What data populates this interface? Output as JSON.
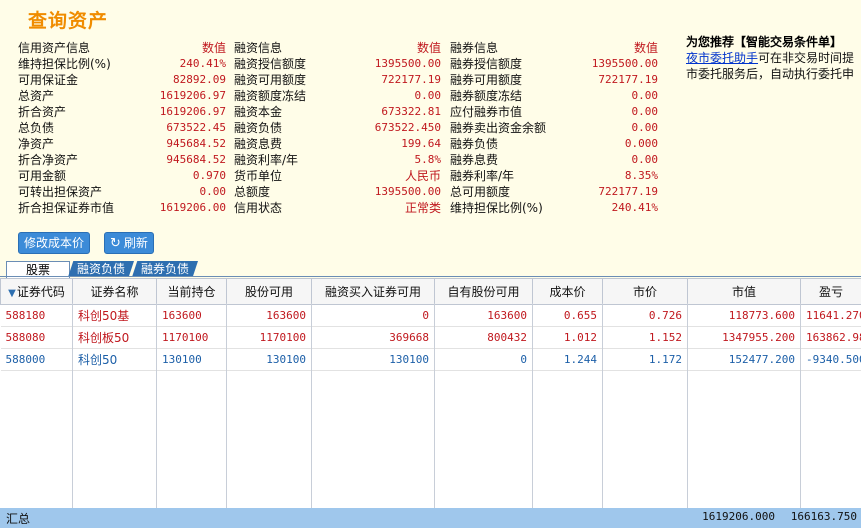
{
  "page_title": "查询资产",
  "credit": {
    "header_label": "信用资产信息",
    "header_value": "数值",
    "rows": [
      {
        "label": "维持担保比例(%)",
        "value": "240.41%"
      },
      {
        "label": "可用保证金",
        "value": "82892.09"
      },
      {
        "label": "总资产",
        "value": "1619206.97"
      },
      {
        "label": "折合资产",
        "value": "1619206.97"
      },
      {
        "label": "总负债",
        "value": "673522.45"
      },
      {
        "label": "净资产",
        "value": "945684.52"
      },
      {
        "label": "折合净资产",
        "value": "945684.52"
      },
      {
        "label": "可用金额",
        "value": "0.970"
      },
      {
        "label": "可转出担保资产",
        "value": "0.00"
      },
      {
        "label": "折合担保证券市值",
        "value": "1619206.00"
      }
    ]
  },
  "margin_finance": {
    "header_label": "融资信息",
    "header_value": "数值",
    "rows": [
      {
        "label": "融资授信额度",
        "value": "1395500.00"
      },
      {
        "label": "融资可用额度",
        "value": "722177.19"
      },
      {
        "label": "融资额度冻结",
        "value": "0.00"
      },
      {
        "label": "融资本金",
        "value": "673322.81"
      },
      {
        "label": "融资负债",
        "value": "673522.450"
      },
      {
        "label": "融资息费",
        "value": "199.64"
      },
      {
        "label": "融资利率/年",
        "value": "5.8%"
      },
      {
        "label": "货币单位",
        "value": "人民币"
      },
      {
        "label": "总额度",
        "value": "1395500.00"
      },
      {
        "label": "信用状态",
        "value": "正常类"
      }
    ]
  },
  "short_sell": {
    "header_label": "融券信息",
    "header_value": "数值",
    "rows": [
      {
        "label": "融券授信额度",
        "value": "1395500.00"
      },
      {
        "label": "融券可用额度",
        "value": "722177.19"
      },
      {
        "label": "融券额度冻结",
        "value": "0.00"
      },
      {
        "label": "应付融券市值",
        "value": "0.00"
      },
      {
        "label": "融券卖出资金余额",
        "value": "0.00"
      },
      {
        "label": "融券负债",
        "value": "0.000"
      },
      {
        "label": "融券息费",
        "value": "0.00"
      },
      {
        "label": "融券利率/年",
        "value": "8.35%"
      },
      {
        "label": "总可用额度",
        "value": "722177.19"
      },
      {
        "label": "维持担保比例(%)",
        "value": "240.41%"
      }
    ]
  },
  "recommend": {
    "title": "为您推荐【智能交易条件单】",
    "link": "夜市委托助手",
    "text1": "可在非交易时间提",
    "text2": "市委托服务后，自动执行委托申"
  },
  "buttons": {
    "modify_cost": "修改成本价",
    "refresh": "刷新"
  },
  "tabs": [
    "股票",
    "融资负债",
    "融券负债"
  ],
  "grid": {
    "headers": [
      "证券代码",
      "证券名称",
      "当前持仓",
      "股份可用",
      "融资买入证券可用",
      "自有股份可用",
      "成本价",
      "市价",
      "市值",
      "盈亏"
    ],
    "rows": [
      {
        "code": "588180",
        "name": "科创50基",
        "hold": "163600",
        "avail": "163600",
        "margin_avail": "0",
        "own_avail": "163600",
        "cost": "0.655",
        "price": "0.726",
        "mv": "118773.600",
        "pl": "11641.270",
        "color": "red"
      },
      {
        "code": "588080",
        "name": "科创板50",
        "hold": "1170100",
        "avail": "1170100",
        "margin_avail": "369668",
        "own_avail": "800432",
        "cost": "1.012",
        "price": "1.152",
        "mv": "1347955.200",
        "pl": "163862.980",
        "color": "red"
      },
      {
        "code": "588000",
        "name": "科创50",
        "hold": "130100",
        "avail": "130100",
        "margin_avail": "130100",
        "own_avail": "0",
        "cost": "1.244",
        "price": "1.172",
        "mv": "152477.200",
        "pl": "-9340.500",
        "color": "blue"
      }
    ]
  },
  "summary": {
    "label": "汇总",
    "mv": "1619206.000",
    "pl": "166163.750"
  },
  "colors": {
    "accent": "#f08c00",
    "value_red": "#c0181e",
    "loss_blue": "#1c5fa8",
    "summary_bg": "#9fc7ec"
  }
}
